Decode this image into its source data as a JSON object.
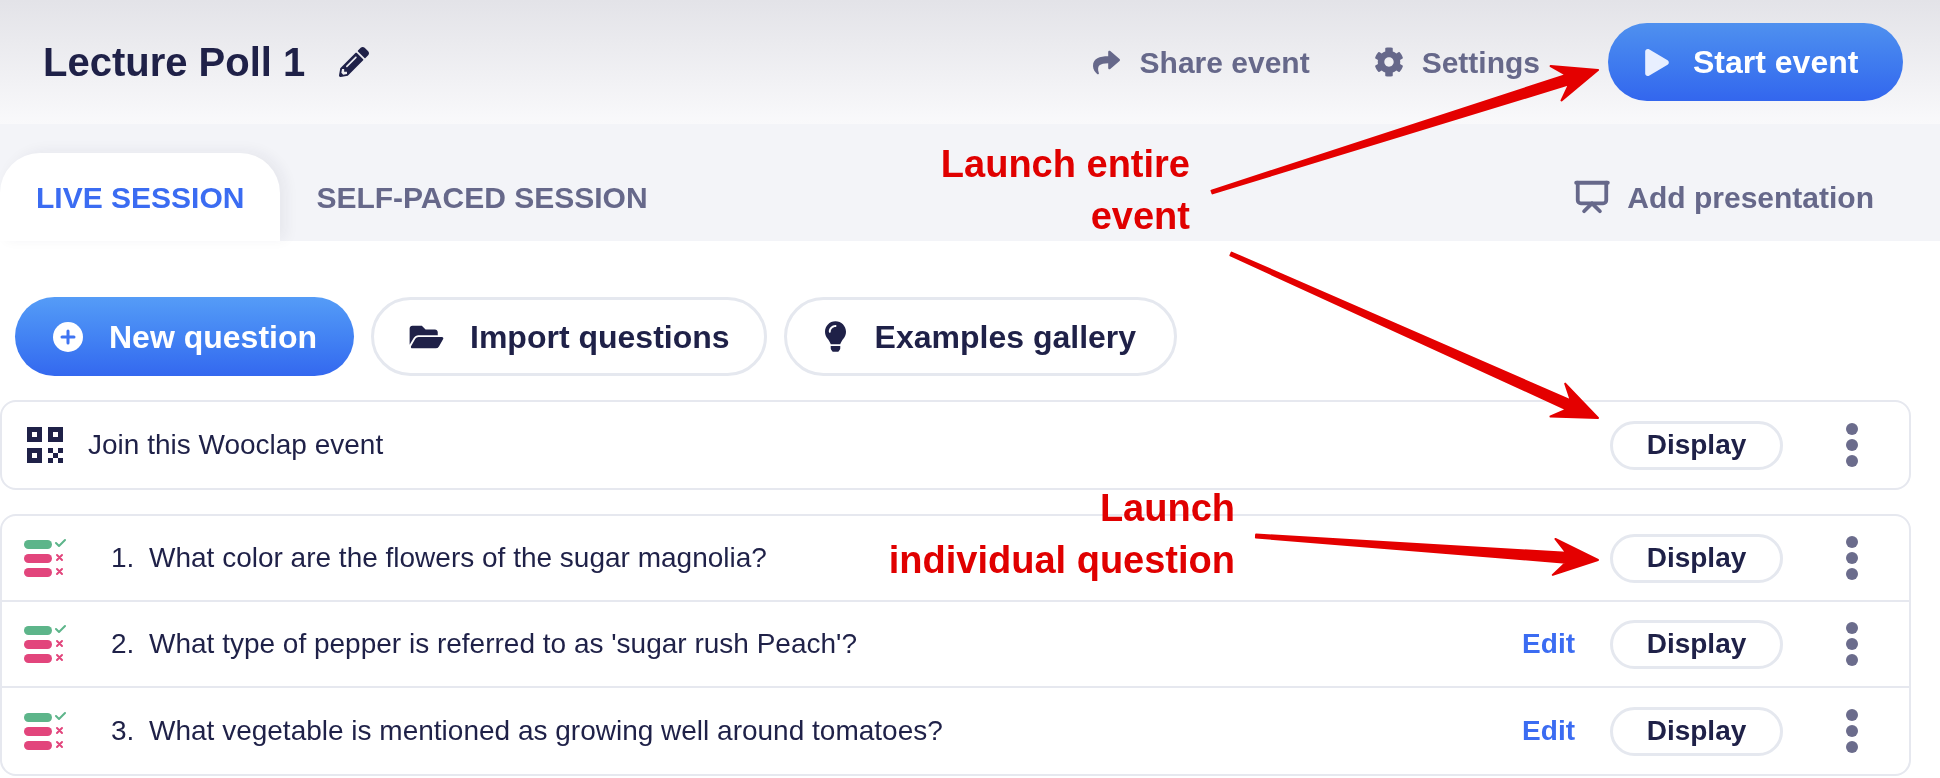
{
  "header": {
    "title": "Lecture Poll 1",
    "actions": [
      {
        "kind": "share",
        "label": "Share event"
      },
      {
        "kind": "settings",
        "label": "Settings"
      }
    ],
    "start_button": "Start event"
  },
  "tabs": [
    {
      "label": "LIVE SESSION",
      "selected": true
    },
    {
      "label": "SELF-PACED SESSION",
      "selected": false
    }
  ],
  "add_presentation": "Add presentation",
  "toolbar": [
    {
      "kind": "new",
      "label": "New question"
    },
    {
      "kind": "import",
      "label": "Import questions"
    },
    {
      "kind": "gallery",
      "label": "Examples gallery"
    }
  ],
  "join_row": {
    "label": "Join this Wooclap event",
    "button": "Display"
  },
  "questions": [
    {
      "number": "1.",
      "text": "What color are the flowers of the sugar magnolia?",
      "button": "Display"
    },
    {
      "number": "2.",
      "text": "What type of pepper is referred to as 'sugar rush Peach'?",
      "edit": "Edit",
      "button": "Display"
    },
    {
      "number": "3.",
      "text": "What vegetable is mentioned as growing well around tomatoes?",
      "edit": "Edit",
      "button": "Display"
    }
  ],
  "annotations": [
    {
      "lines": [
        "Launch entire",
        "event"
      ]
    },
    {
      "lines": [
        "Launch",
        "individual question"
      ]
    }
  ]
}
